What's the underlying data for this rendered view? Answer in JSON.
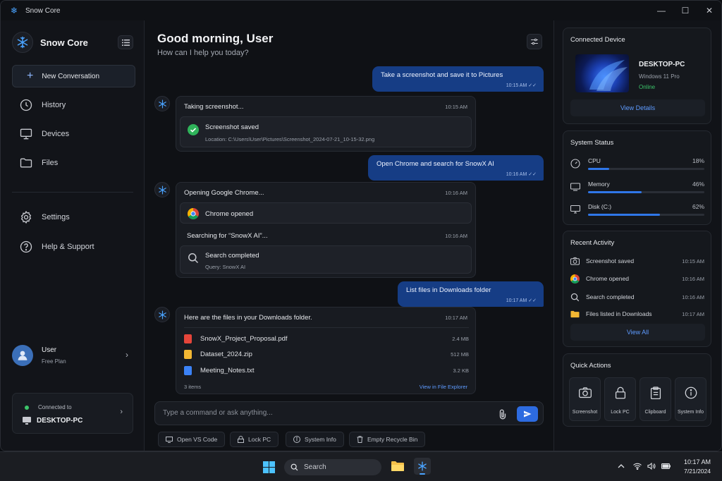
{
  "window": {
    "title": "Snow Core",
    "minimize": "—",
    "maximize": "☐",
    "close": "✕"
  },
  "sidebar": {
    "brand": "Snow Core",
    "new_conversation": "New Conversation",
    "nav": [
      {
        "label": "History",
        "icon": "clock-icon"
      },
      {
        "label": "Devices",
        "icon": "monitor-icon"
      },
      {
        "label": "Files",
        "icon": "folder-icon"
      },
      {
        "label": "Settings",
        "icon": "gear-icon"
      },
      {
        "label": "Help & Support",
        "icon": "help-icon"
      }
    ],
    "user": {
      "name": "User",
      "plan": "Free Plan"
    },
    "connection": {
      "label": "Connected to",
      "device": "DESKTOP-PC"
    }
  },
  "main": {
    "greeting": "Good morning, User",
    "subtitle": "How can I help you today?",
    "messages": {
      "u1": {
        "text": "Take a screenshot and save it to Pictures",
        "time": "10:15 AM"
      },
      "b1": {
        "title": "Taking screenshot...",
        "time": "10:15 AM",
        "result": "Screenshot saved",
        "detail": "Location: C:\\Users\\User\\Pictures\\Screenshot_2024-07-21_10-15-32.png"
      },
      "u2": {
        "text": "Open Chrome and search for SnowX AI",
        "time": "10:16 AM"
      },
      "b2": {
        "title": "Opening Google Chrome...",
        "time": "10:16 AM",
        "result": "Chrome opened",
        "title2": "Searching for “SnowX AI”...",
        "time2": "10:16 AM",
        "result2": "Search completed",
        "detail2": "Query: SnowX AI"
      },
      "u3": {
        "text": "List files in Downloads folder",
        "time": "10:17 AM"
      },
      "b3": {
        "title": "Here are the files in your Downloads folder.",
        "time": "10:17 AM",
        "files": [
          {
            "name": "SnowX_Project_Proposal.pdf",
            "size": "2.4 MB",
            "color": "#e5453a"
          },
          {
            "name": "Dataset_2024.zip",
            "size": "512 MB",
            "color": "#f2b733"
          },
          {
            "name": "Meeting_Notes.txt",
            "size": "3.2 KB",
            "color": "#3b82f6"
          }
        ],
        "count": "3 items",
        "link": "View in File Explorer"
      }
    },
    "composer": {
      "placeholder": "Type a command or ask anything..."
    },
    "chips": [
      "Open VS Code",
      "Lock PC",
      "System Info",
      "Empty Recycle Bin"
    ]
  },
  "right": {
    "device": {
      "title": "Connected Device",
      "name": "DESKTOP-PC",
      "os": "Windows 11 Pro",
      "status": "Online",
      "button": "View Details"
    },
    "system": {
      "title": "System Status",
      "stats": [
        {
          "label": "CPU",
          "value": "18%",
          "pct": 18
        },
        {
          "label": "Memory",
          "value": "46%",
          "pct": 46
        },
        {
          "label": "Disk (C:)",
          "value": "62%",
          "pct": 62
        }
      ]
    },
    "activity": {
      "title": "Recent Activity",
      "items": [
        {
          "label": "Screenshot saved",
          "time": "10:15 AM"
        },
        {
          "label": "Chrome opened",
          "time": "10:16 AM"
        },
        {
          "label": "Search completed",
          "time": "10:16 AM"
        },
        {
          "label": "Files listed in Downloads",
          "time": "10:17 AM"
        }
      ],
      "button": "View All"
    },
    "quick": {
      "title": "Quick Actions",
      "items": [
        "Screenshot",
        "Lock PC",
        "Clipboard",
        "System Info"
      ]
    }
  },
  "taskbar": {
    "search": "Search",
    "time": "10:17 AM",
    "date": "7/21/2024"
  },
  "colors": {
    "accent": "#2d6be0",
    "user_bubble": "#163d85",
    "online": "#3cc46a"
  }
}
